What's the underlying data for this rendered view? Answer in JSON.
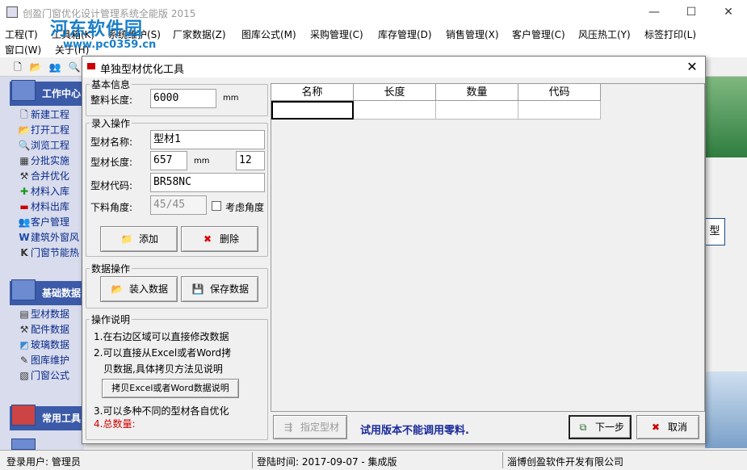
{
  "window": {
    "title": "创盈门窗优化设计管理系统全能版 2015",
    "minimize": "—",
    "maximize": "☐",
    "close": "✕"
  },
  "watermark": {
    "line1": "河东软件园",
    "line2": "www.pc0359.cn"
  },
  "menu": [
    {
      "label": "工程(T)"
    },
    {
      "label": "工具箱(K)"
    },
    {
      "label": "系统维护(S)"
    },
    {
      "label": "厂家数据(Z)"
    },
    {
      "label": "图库公式(M)"
    },
    {
      "label": "采购管理(C)"
    },
    {
      "label": "库存管理(D)"
    },
    {
      "label": "销售管理(X)"
    },
    {
      "label": "客户管理(C)"
    },
    {
      "label": "风压热工(Y)"
    },
    {
      "label": "标签打印(L)"
    },
    {
      "label": "窗口(W)"
    },
    {
      "label": "关于(H)"
    }
  ],
  "sidebar": {
    "group1": {
      "title": "工作中心",
      "items": [
        {
          "label": "新建工程",
          "icon": "new-file-icon"
        },
        {
          "label": "打开工程",
          "icon": "open-folder-icon"
        },
        {
          "label": "浏览工程",
          "icon": "magnifier-icon"
        },
        {
          "label": "分批实施",
          "icon": "calendar-icon"
        },
        {
          "label": "合并优化",
          "icon": "tools-icon"
        },
        {
          "label": "材料入库",
          "icon": "plus-icon"
        },
        {
          "label": "材料出库",
          "icon": "minus-icon"
        },
        {
          "label": "客户管理",
          "icon": "users-icon"
        },
        {
          "label": "建筑外窗风",
          "icon": "word-doc-icon"
        },
        {
          "label": "门窗节能热",
          "icon": "k-icon"
        }
      ]
    },
    "group2": {
      "title": "基础数据",
      "items": [
        {
          "label": "型材数据",
          "icon": "chart-icon"
        },
        {
          "label": "配件数据",
          "icon": "tools-icon"
        },
        {
          "label": "玻璃数据",
          "icon": "glass-icon"
        },
        {
          "label": "图库维护",
          "icon": "pen-icon"
        },
        {
          "label": "门窗公式",
          "icon": "formula-icon"
        }
      ]
    },
    "group3": {
      "title": "常用工具"
    }
  },
  "right_edge_button": "型",
  "statusbar": {
    "user": "登录用户: 管理员",
    "login_time": "登陆时间: 2017-09-07 - 集成版",
    "company": "淄博创盈软件开发有限公司"
  },
  "dialog": {
    "title": "单独型材优化工具",
    "close": "✕",
    "basic": {
      "legend": "基本信息",
      "length_label": "整料长度:",
      "length_value": "6000",
      "length_unit": "mm"
    },
    "entry": {
      "legend": "录入操作",
      "name_label": "型材名称:",
      "name_value": "型材1",
      "len_label": "型材长度:",
      "len_value": "657",
      "len_unit": "mm",
      "qty_value": "12",
      "code_label": "型材代码:",
      "code_value": "BR58NC",
      "angle_label": "下料角度:",
      "angle_value": "45/45",
      "angle_check_label": "考虑角度",
      "add_button": "添加",
      "delete_button": "删除"
    },
    "data_ops": {
      "legend": "数据操作",
      "load_button": "装入数据",
      "save_button": "保存数据"
    },
    "help": {
      "legend": "操作说明",
      "line1": "1.在右边区域可以直接修改数据",
      "line2a": "2.可以直接从Excel或者Word拷",
      "line2b": "贝数据,具体拷贝方法见说明",
      "copy_button": "拷贝Excel或者Word数据说明",
      "line3": "3.可以多种不同的型材各自优化",
      "line4": "4.总数量:"
    },
    "grid": {
      "headers": [
        "名称",
        "长度",
        "数量",
        "代码"
      ]
    },
    "footer": {
      "assign_button": "指定型材",
      "notice": "试用版本不能调用零料.",
      "next_button": "下一步",
      "cancel_button": "取消"
    }
  },
  "colors": {
    "notice": "#1a2a9a",
    "total_label": "#d00000",
    "sidebar_text": "#0a2a8a"
  }
}
